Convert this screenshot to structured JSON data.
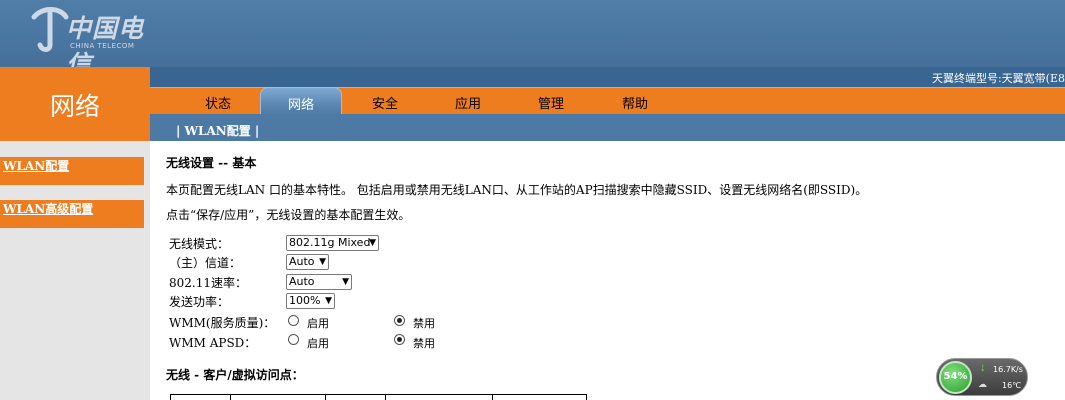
{
  "header": {
    "logo_cn": "中国电信",
    "logo_en": "CHINA TELECOM"
  },
  "section_title": "网络",
  "model_bar": {
    "text": "天翼终端型号:天翼宽带(E8"
  },
  "nav": {
    "tabs": [
      {
        "label": "状态"
      },
      {
        "label": "网络"
      },
      {
        "label": "安全"
      },
      {
        "label": "应用"
      },
      {
        "label": "管理"
      },
      {
        "label": "帮助"
      }
    ],
    "active": "网络"
  },
  "subnav": {
    "item": "| WLAN配置 |"
  },
  "sidebar": {
    "items": [
      {
        "label": "WLAN配置"
      },
      {
        "label": "WLAN高级配置"
      }
    ]
  },
  "content": {
    "title": "无线设置 -- 基本",
    "desc1": "本页配置无线LAN 口的基本特性。 包括启用或禁用无线LAN口、从工作站的AP扫描搜索中隐藏SSID、设置无线网络名(即SSID)。",
    "desc2": "点击“保存/应用”，无线设置的基本配置生效。",
    "fields": {
      "mode_label": "无线模式：",
      "mode_value": "802.11g Mixed",
      "channel_label": "（主）信道：",
      "channel_value": "Auto",
      "rate_label": "802.11速率：",
      "rate_value": "Auto",
      "power_label": "发送功率：",
      "power_value": "100%",
      "wmm_label": "WMM(服务质量)：",
      "wmm_apsd_label": "WMM APSD：",
      "enable_label": "启用",
      "disable_label": "禁用"
    },
    "wmm_selected": "禁用",
    "wmm_apsd_selected": "禁用",
    "ap_title": "无线 - 客户/虚拟访问点："
  },
  "widget": {
    "percent": "54%",
    "speed": "16.7K/s",
    "temp": "16℃"
  },
  "colors": {
    "orange": "#ee7d1f",
    "blue": "#4c7aa5",
    "dark_blue": "#386591"
  }
}
